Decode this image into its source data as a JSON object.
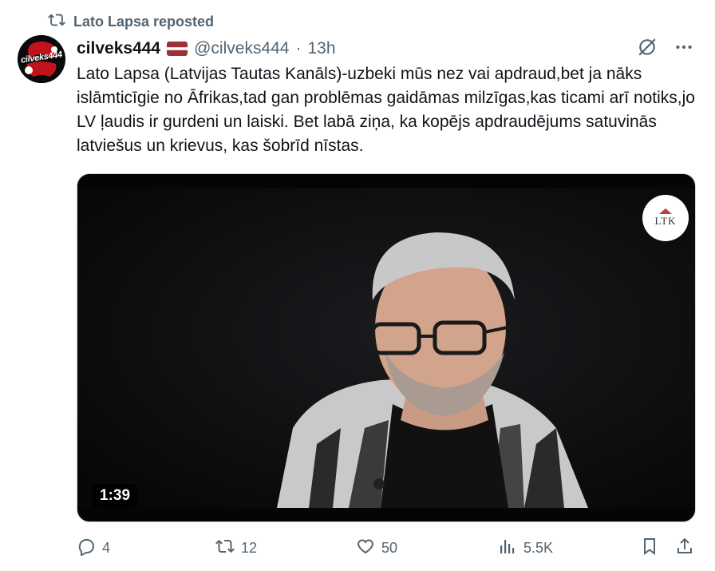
{
  "repost": {
    "label": "Lato Lapsa reposted"
  },
  "author": {
    "avatar_text": "cilveks444",
    "display_name": "cilveks444",
    "handle": "@cilveks444",
    "separator": "·",
    "time": "13h"
  },
  "tweet": {
    "text": "Lato Lapsa (Latvijas Tautas Kanāls)-uzbeki mūs nez vai apdraud,bet ja nāks islāmticīgie no Āfrikas,tad gan problēmas gaidāmas milzīgas,kas ticami arī notiks,jo LV ļaudis ir gurdeni un laiski. Bet labā ziņa, ka kopējs apdraudējums satuvinās latviešus un krievus, kas šobrīd nīstas."
  },
  "media": {
    "channel_logo_text": "LTK",
    "duration": "1:39"
  },
  "actions": {
    "replies": "4",
    "reposts": "12",
    "likes": "50",
    "views": "5.5K"
  },
  "colors": {
    "accent": "#1d9bf0",
    "muted": "#536471",
    "flag_red": "#9e3039"
  }
}
